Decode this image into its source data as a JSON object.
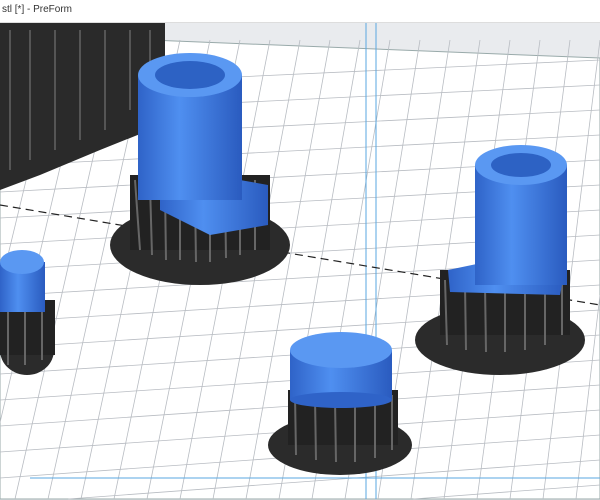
{
  "window": {
    "title": "stl [*] - PreForm"
  },
  "colors": {
    "part": "#3f7fe0",
    "support": "#1e1e1e",
    "plate": "#ffffff",
    "grid": "#b8bcc2",
    "bounds": "#5aa7e0"
  }
}
